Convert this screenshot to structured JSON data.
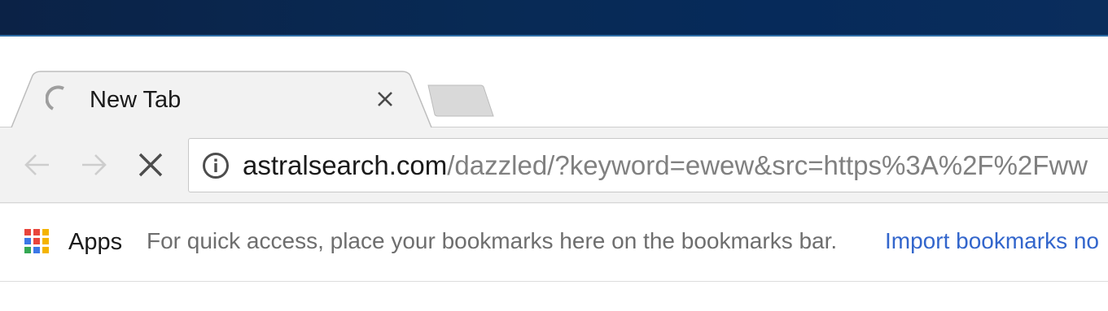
{
  "tab": {
    "title": "New Tab",
    "favicon": "loading-spinner-icon",
    "close_icon": "close-icon"
  },
  "new_tab_button": {
    "icon": "new-tab-icon"
  },
  "toolbar": {
    "back_icon": "back-arrow-icon",
    "forward_icon": "forward-arrow-icon",
    "stop_icon": "stop-loading-icon"
  },
  "omnibox": {
    "info_icon": "info-icon",
    "host": "astralsearch.com",
    "path": "/dazzled/?keyword=ewew&src=https%3A%2F%2Fww"
  },
  "bookmarks_bar": {
    "apps_label": "Apps",
    "apps_icon": "apps-grid-icon",
    "hint": "For quick access, place your bookmarks here on the bookmarks bar.",
    "import_link": "Import bookmarks no"
  },
  "colors": {
    "desktop_bg": "#0a2a55",
    "tab_bg": "#f2f2f2",
    "link": "#3366cc",
    "url_path": "#808080"
  }
}
